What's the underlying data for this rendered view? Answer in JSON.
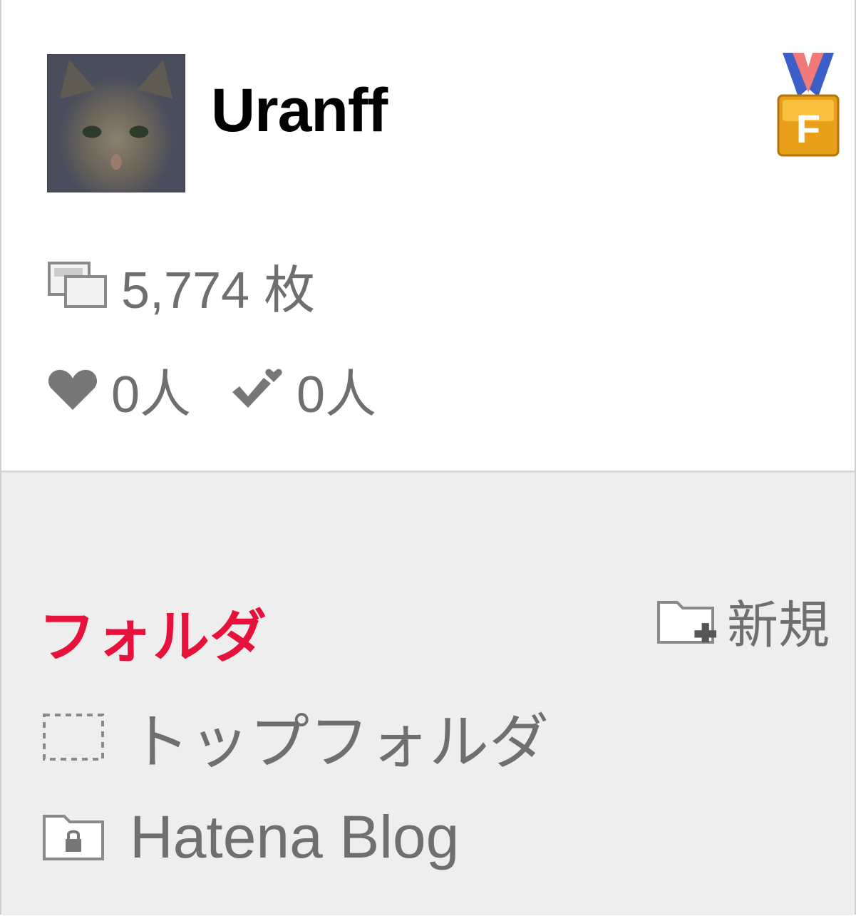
{
  "profile": {
    "username": "Uranff",
    "avatar_icon": "cat-avatar",
    "badge_icon": "medal-f-icon",
    "badge_letter": "F"
  },
  "stats": {
    "photo_count": "5,774 枚",
    "favorites_count": "0人",
    "followers_count": "0人"
  },
  "folders": {
    "heading": "フォルダ",
    "new_label": "新規",
    "items": [
      {
        "label": "トップフォルダ",
        "icon": "dashed-folder-icon"
      },
      {
        "label": "Hatena Blog",
        "icon": "locked-folder-icon"
      }
    ]
  },
  "colors": {
    "accent": "#e6123c",
    "muted_text": "#6f6f6f",
    "folder_bg": "#eeeeee"
  }
}
